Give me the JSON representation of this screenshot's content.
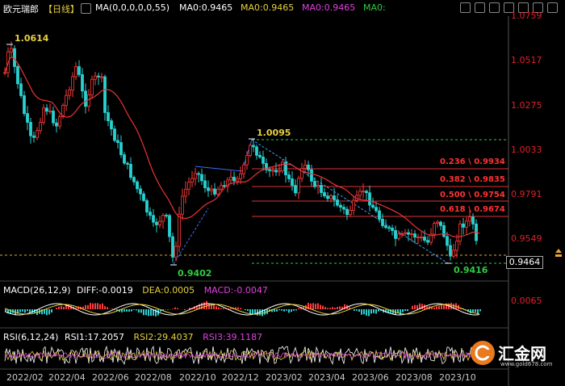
{
  "header": {
    "symbol": "欧元瑞郎",
    "period": "【日线】",
    "ma_params": "MA(0,0,0,0,0,55)",
    "ma_value": "MA0:0.9465",
    "ma1": "MA0:0.9465",
    "ma2": "MA0:0.9465",
    "ma3": "MA0:"
  },
  "y_axis": [
    "1.0759",
    "1.0517",
    "1.0275",
    "1.0033",
    "0.9791",
    "0.9549"
  ],
  "current_price": "0.9464",
  "annotations": {
    "high_start": "1.0614",
    "low1": "0.9402",
    "high2": "1.0095",
    "low2": "0.9416"
  },
  "fibonacci": [
    {
      "label": "0.236 \\ 0.9934"
    },
    {
      "label": "0.382 \\ 0.9835"
    },
    {
      "label": "0.500 \\ 0.9754"
    },
    {
      "label": "0.618 \\ 0.9674"
    }
  ],
  "macd": {
    "title": "MACD(26,12,9)",
    "diff": "DIFF:-0.0019",
    "dea": "DEA:0.0005",
    "macd": "MACD:-0.0047",
    "axis_label": "0.0065"
  },
  "rsi": {
    "title": "RSI(6,12,24)",
    "rsi1": "RSI1:17.2057",
    "rsi2": "RSI2:29.4037",
    "rsi3": "RSI3:39.1187"
  },
  "x_axis": [
    "2022/02",
    "2022/04",
    "2022/06",
    "2022/08",
    "2022/10",
    "2022/12",
    "2023/02",
    "2023/04",
    "2023/06",
    "2023/08",
    "2023/10"
  ],
  "watermark": {
    "text": "汇金网",
    "url": "www.gold678.com"
  },
  "colors": {
    "up": "#ff3b3b",
    "down": "#2ad0d0",
    "ma": "#e33",
    "fib": "#e33",
    "dash": "#2ecc40",
    "trend": "#3b6fff"
  }
}
